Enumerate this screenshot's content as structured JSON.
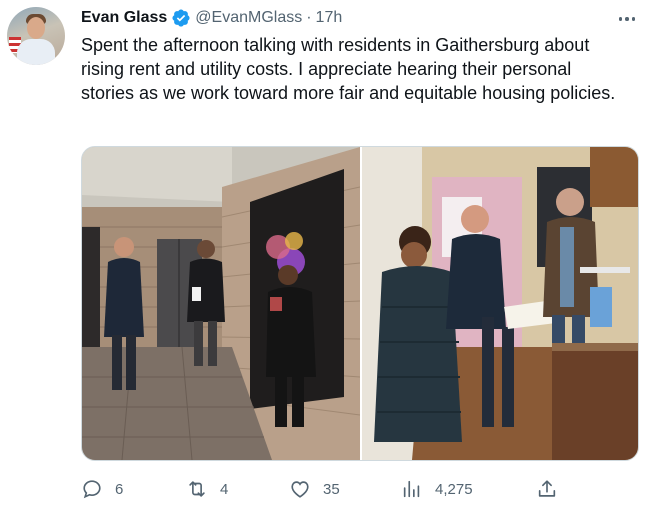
{
  "author": {
    "name": "Evan Glass",
    "handle": "@EvanMGlass",
    "separator": "·",
    "time": "17h",
    "verified": true
  },
  "tweet": {
    "text": "Spent the afternoon talking with residents in Gaithersburg about rising rent and utility costs. I appreciate hearing their personal stories as we work toward more fair and equitable housing policies."
  },
  "media": {
    "count": 2
  },
  "metrics": {
    "replies": "6",
    "retweets": "4",
    "likes": "35",
    "views": "4,275"
  },
  "icons": {
    "verified": "verified-badge-icon",
    "more": "more-dots-icon",
    "reply": "reply-icon",
    "retweet": "retweet-icon",
    "like": "heart-icon",
    "views": "views-icon",
    "share": "share-icon"
  },
  "colors": {
    "verified_blue": "#1d9bf0",
    "secondary_text": "#536471",
    "primary_text": "#0f1419"
  }
}
